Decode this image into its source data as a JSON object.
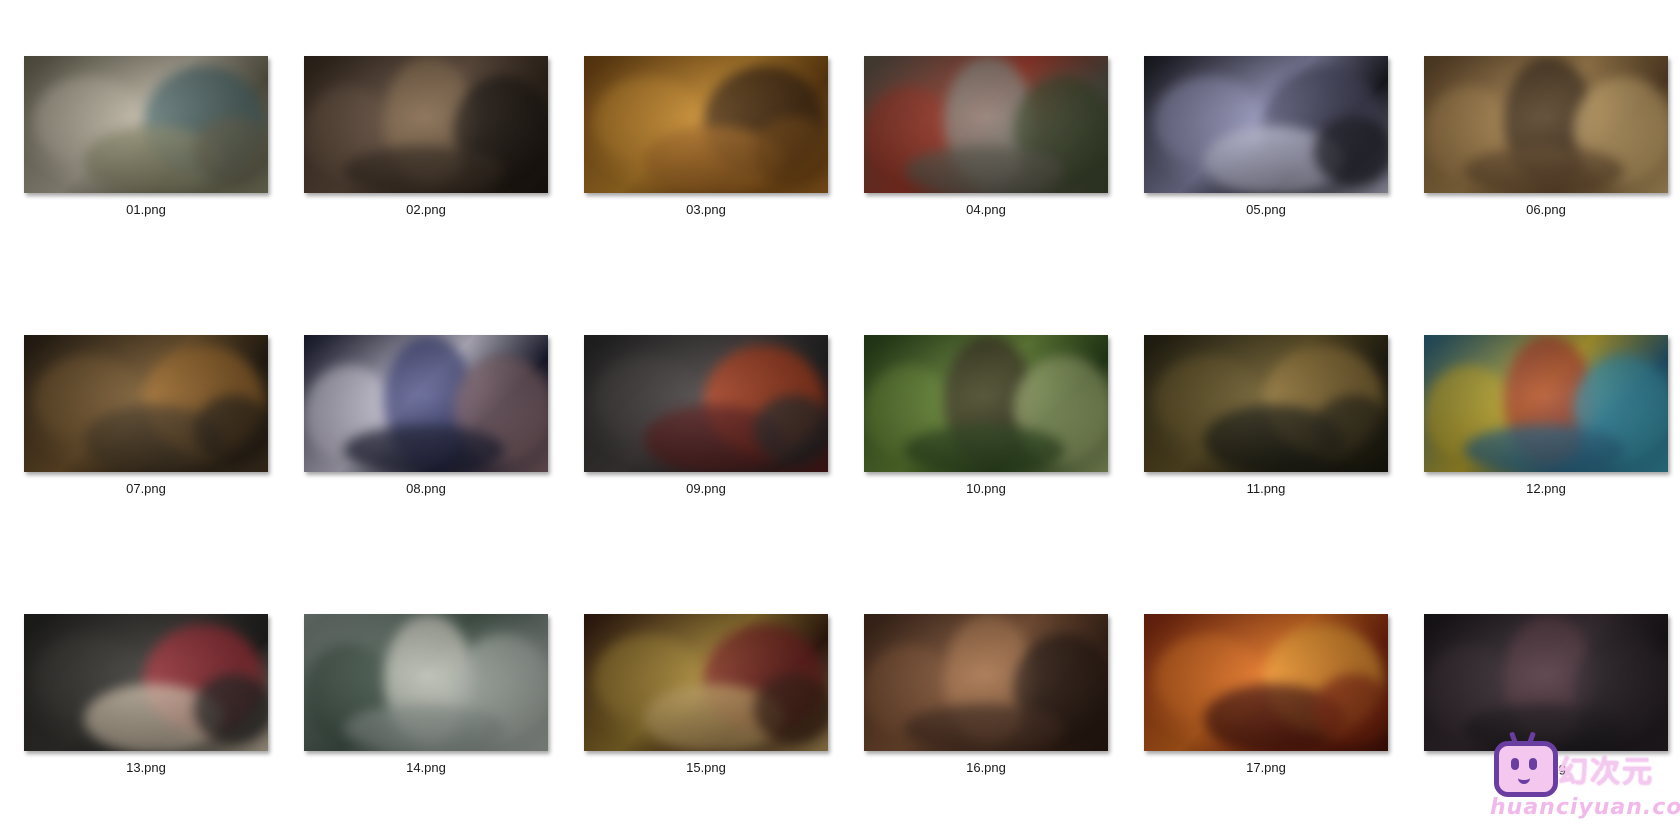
{
  "files": [
    {
      "name": "01.png",
      "colors": [
        "#6d6a55",
        "#bdb5a3",
        "#4a6a6e",
        "#8b8a6b"
      ]
    },
    {
      "name": "02.png",
      "colors": [
        "#3a2d22",
        "#6b5443",
        "#8c7050",
        "#1e1712"
      ]
    },
    {
      "name": "03.png",
      "colors": [
        "#7a4a14",
        "#c78a2c",
        "#3b2410",
        "#a86a22"
      ]
    },
    {
      "name": "04.png",
      "colors": [
        "#5d5a4e",
        "#a33a2a",
        "#8d8f86",
        "#3e4a2c"
      ]
    },
    {
      "name": "05.png",
      "colors": [
        "#1d1d26",
        "#8f8fb5",
        "#4a4a66",
        "#c0c0d8"
      ]
    },
    {
      "name": "06.png",
      "colors": [
        "#6d5030",
        "#b08a52",
        "#3a2a1a",
        "#d4b070"
      ]
    },
    {
      "name": "07.png",
      "colors": [
        "#2e2418",
        "#7a5a30",
        "#a8702c",
        "#4a3a24"
      ]
    },
    {
      "name": "08.png",
      "colors": [
        "#1e2038",
        "#d7d3e4",
        "#3a3f7a",
        "#8a6a70"
      ]
    },
    {
      "name": "09.png",
      "colors": [
        "#2b2b2b",
        "#4a4444",
        "#c0401a",
        "#5a1a1a"
      ]
    },
    {
      "name": "10.png",
      "colors": [
        "#2e4a1e",
        "#6d8f3a",
        "#3a3020",
        "#a0b070"
      ]
    },
    {
      "name": "11.png",
      "colors": [
        "#2a2616",
        "#6b5a2a",
        "#9a7a3a",
        "#1a1a10"
      ]
    },
    {
      "name": "12.png",
      "colors": [
        "#2b6a8a",
        "#c8b030",
        "#b03a2a",
        "#3a9ab0"
      ]
    },
    {
      "name": "13.png",
      "colors": [
        "#262624",
        "#3c3a36",
        "#b0303a",
        "#d8c8b0"
      ]
    },
    {
      "name": "14.png",
      "colors": [
        "#8f9a94",
        "#4a5e52",
        "#d8d8cc",
        "#b0b8b0"
      ]
    },
    {
      "name": "15.png",
      "colors": [
        "#3a1e12",
        "#a08030",
        "#7a1e1e",
        "#c0a060"
      ]
    },
    {
      "name": "16.png",
      "colors": [
        "#4a2e20",
        "#8a5a3a",
        "#b07a50",
        "#2a1a12"
      ]
    },
    {
      "name": "17.png",
      "colors": [
        "#8a2a10",
        "#e07020",
        "#f0a030",
        "#4a1208"
      ]
    },
    {
      "name": "18.png",
      "colors": [
        "#1e1a1e",
        "#3a2e34",
        "#5a3a44",
        "#2a2228"
      ]
    }
  ],
  "watermark": {
    "chinese": "幻次元",
    "url": "huanciyuan.com"
  }
}
